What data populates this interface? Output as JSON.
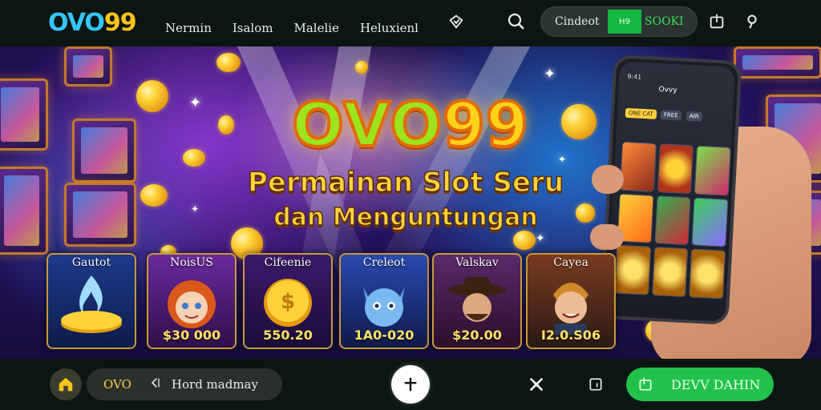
{
  "brand": {
    "logo_part1": "OVO",
    "logo_part2": "99"
  },
  "nav": {
    "items": [
      "Nermin",
      "Isalom",
      "Malelie",
      "Heluxienl"
    ]
  },
  "header_icons": [
    "heart-shield-icon",
    "search-icon",
    "share-box-icon",
    "user-icon"
  ],
  "auth": {
    "login_label": "Cindeot",
    "register_badge": "H9",
    "register_label": "SOOKI"
  },
  "hero": {
    "title_part1": "OVO",
    "title_part2": "99",
    "tagline_line1": "Permainan Slot Seru",
    "tagline_line2": "dan Menguntungan"
  },
  "games": [
    {
      "title": "Gautot",
      "prize": "",
      "icon": "blue-flame-coin"
    },
    {
      "title": "NoisUS",
      "prize": "$30 000",
      "icon": "fox-girl-character"
    },
    {
      "title": "Cifeenie",
      "prize": "550.20",
      "icon": "gold-coin-stack"
    },
    {
      "title": "Creleot",
      "prize": "1A0-020",
      "icon": "blue-cat-character"
    },
    {
      "title": "Valskav",
      "prize": "$20.00",
      "icon": "cowboy-character"
    },
    {
      "title": "Cayea",
      "prize": "I2.0.S06",
      "icon": "smiling-man-character"
    }
  ],
  "phone": {
    "status_text": "9:41",
    "app_title": "Ovvy",
    "chip1": "ONE CAT",
    "chip2": "FREE",
    "chip3": "AIR"
  },
  "bottombar": {
    "code_label": "OVO",
    "search_text": "Hord madmay",
    "play_label": "DEVV DAHIN"
  },
  "colors": {
    "accent_green": "#22c24a",
    "gold": "#ffd23a",
    "logo_blue": "#35c6ff",
    "bar_bg": "#0b1511"
  }
}
